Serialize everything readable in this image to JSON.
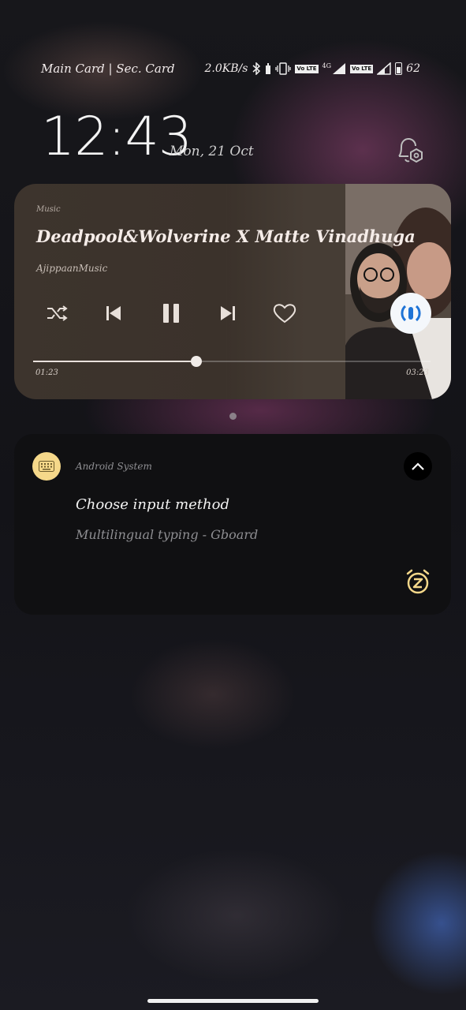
{
  "status_bar": {
    "carrier": "Main Card | Sec. Card",
    "net_speed": "2.0KB/s",
    "lte_label": "Vo LTE",
    "fourg_label": "4G",
    "battery": "62"
  },
  "lockscreen": {
    "time": "12:43",
    "date": "Mon, 21 Oct"
  },
  "music": {
    "app_name": "Music",
    "title": "Deadpool&Wolverine X Matte Vinadhuga",
    "artist": "AjippaanMusic",
    "current_time": "01:23",
    "total_time": "03:23",
    "progress": 0.41
  },
  "notification": {
    "app": "Android System",
    "title": "Choose input method",
    "text": "Multilingual typing - Gboard"
  },
  "colors": {
    "accent_yellow": "#f5d88a",
    "cast_blue": "#1e73d6"
  }
}
